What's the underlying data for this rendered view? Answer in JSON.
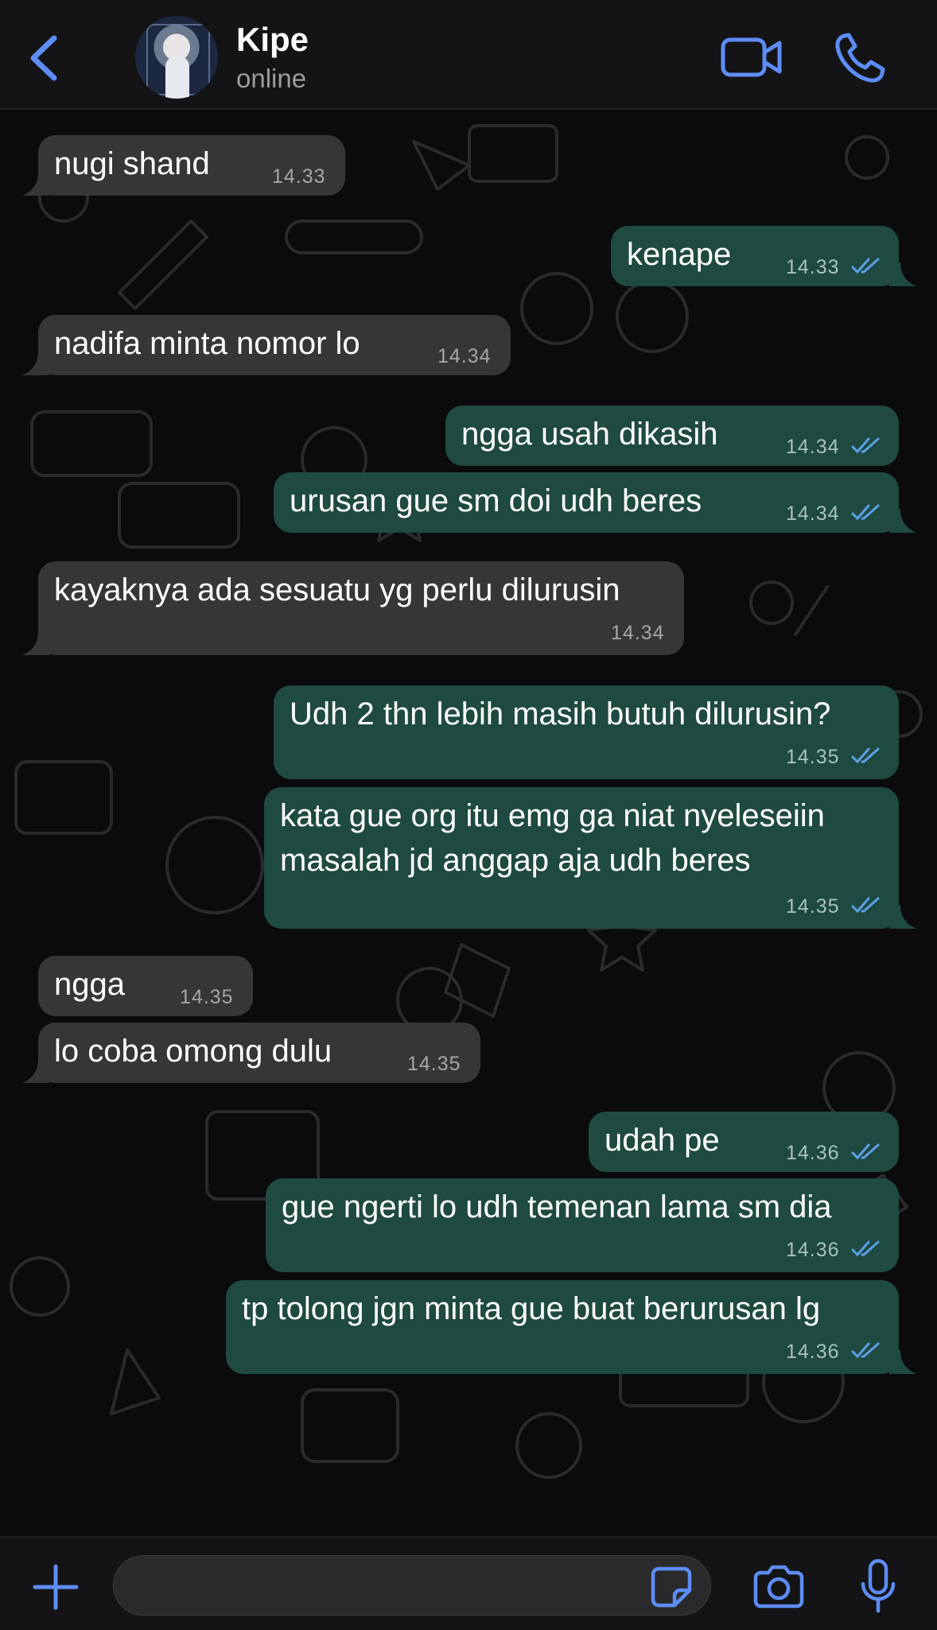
{
  "colors": {
    "accent": "#5d8df5",
    "incoming_bubble": "#363639",
    "outgoing_bubble": "#1f4a41",
    "read_ticks": "#5b9fe6",
    "background": "#0b0b0d"
  },
  "header": {
    "contact_name": "Kipe",
    "contact_status": "online",
    "icons": [
      "chevron-left-icon",
      "avatar",
      "video-camera-icon",
      "phone-icon"
    ]
  },
  "messages": [
    {
      "direction": "in",
      "text": "nugi shand",
      "time": "14.33"
    },
    {
      "direction": "out",
      "text": "kenape",
      "time": "14.33",
      "read": true
    },
    {
      "direction": "in",
      "text": "nadifa minta nomor lo",
      "time": "14.34"
    },
    {
      "direction": "out",
      "text": "ngga usah dikasih",
      "time": "14.34",
      "read": true
    },
    {
      "direction": "out",
      "text": "urusan gue sm doi udh beres",
      "time": "14.34",
      "read": true
    },
    {
      "direction": "in",
      "text": "kayaknya ada sesuatu yg perlu dilurusin",
      "time": "14.34"
    },
    {
      "direction": "out",
      "text": "Udh 2 thn lebih masih butuh dilurusin?",
      "time": "14.35",
      "read": true
    },
    {
      "direction": "out",
      "lines": [
        "kata gue org itu emg ga niat nyeleseiin",
        "masalah jd anggap aja udh beres"
      ],
      "time": "14.35",
      "read": true
    },
    {
      "direction": "in",
      "text": "ngga",
      "time": "14.35"
    },
    {
      "direction": "in",
      "text": "lo coba omong dulu",
      "time": "14.35"
    },
    {
      "direction": "out",
      "text": "udah pe",
      "time": "14.36",
      "read": true
    },
    {
      "direction": "out",
      "text": "gue ngerti lo udh temenan lama sm dia",
      "time": "14.36",
      "read": true
    },
    {
      "direction": "out",
      "text": "tp tolong jgn minta gue buat berurusan lg",
      "time": "14.36",
      "read": true
    }
  ],
  "input": {
    "placeholder": "",
    "icons": [
      "plus-icon",
      "sticker-icon",
      "camera-icon",
      "microphone-icon"
    ]
  }
}
